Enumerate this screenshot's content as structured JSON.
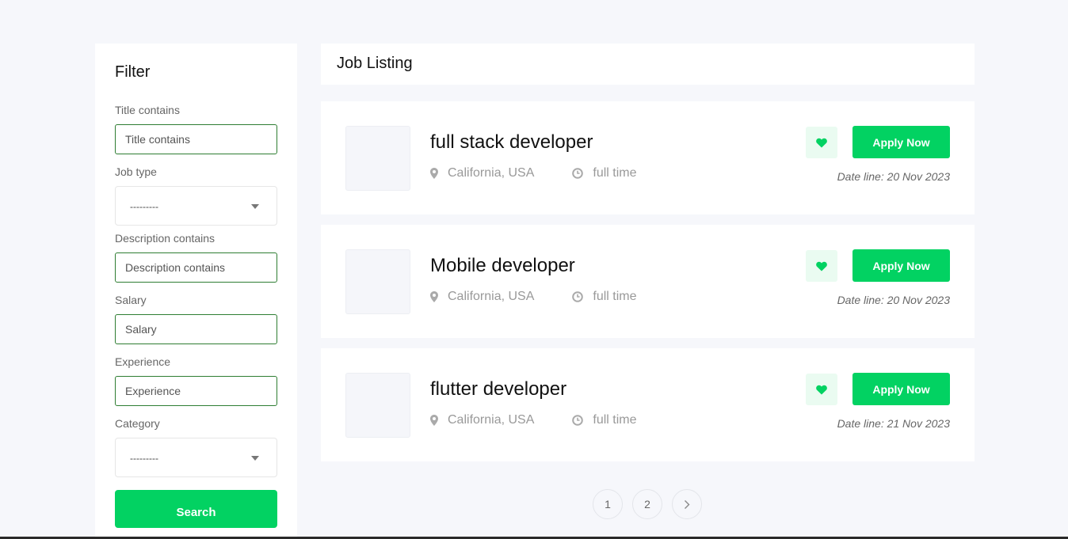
{
  "filter": {
    "title": "Filter",
    "fields": {
      "title_contains": {
        "label": "Title contains",
        "placeholder": "Title contains"
      },
      "job_type": {
        "label": "Job type",
        "selected": "---------"
      },
      "description_contains": {
        "label": "Description contains",
        "placeholder": "Description contains"
      },
      "salary": {
        "label": "Salary",
        "placeholder": "Salary"
      },
      "experience": {
        "label": "Experience",
        "placeholder": "Experience"
      },
      "category": {
        "label": "Category",
        "selected": "---------"
      }
    },
    "search_label": "Search"
  },
  "header": {
    "title": "Job Listing"
  },
  "jobs": [
    {
      "title": "full stack developer",
      "location": "California, USA",
      "type": "full time",
      "apply_label": "Apply Now",
      "deadline": "Date line: 20 Nov 2023"
    },
    {
      "title": "Mobile developer",
      "location": "California, USA",
      "type": "full time",
      "apply_label": "Apply Now",
      "deadline": "Date line: 20 Nov 2023"
    },
    {
      "title": "flutter developer",
      "location": "California, USA",
      "type": "full time",
      "apply_label": "Apply Now",
      "deadline": "Date line: 21 Nov 2023"
    }
  ],
  "pagination": {
    "pages": [
      "1",
      "2"
    ],
    "next_icon": "chevron-right-icon"
  },
  "colors": {
    "accent": "#02d262",
    "input_border": "#2e7d32",
    "background": "#f6f7fb"
  }
}
